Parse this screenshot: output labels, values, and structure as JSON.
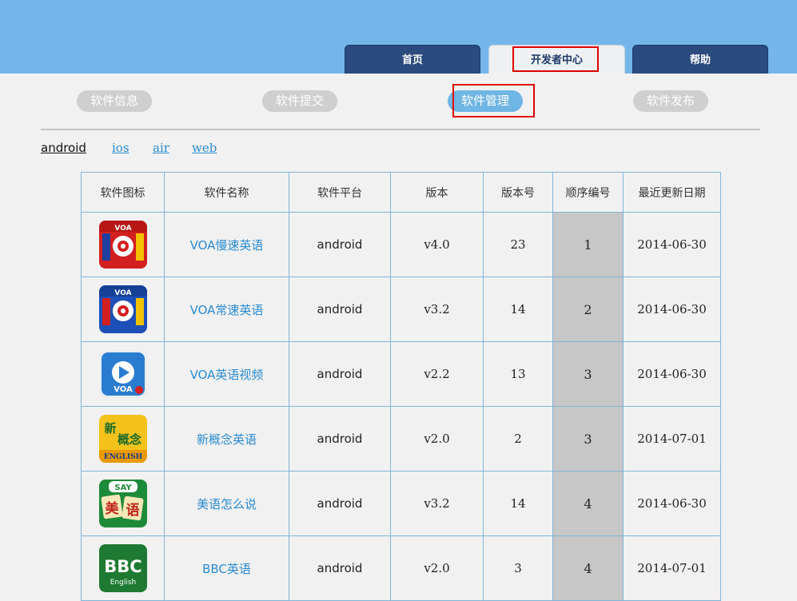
{
  "nav": {
    "tabs": [
      {
        "label": "首页"
      },
      {
        "label": "开发者中心"
      },
      {
        "label": "帮助"
      }
    ]
  },
  "subnav": {
    "items": [
      {
        "label": "软件信息"
      },
      {
        "label": "软件提交"
      },
      {
        "label": "软件管理"
      },
      {
        "label": "软件发布"
      }
    ]
  },
  "platforms": [
    "android",
    "ios",
    "air",
    "web"
  ],
  "table": {
    "headers": [
      "软件图标",
      "软件名称",
      "软件平台",
      "版本",
      "版本号",
      "顺序编号",
      "最近更新日期"
    ],
    "rows": [
      {
        "icon": "voa-slow-icon",
        "name": "VOA慢速英语",
        "platform": "android",
        "version": "v4.0",
        "build": "23",
        "order": "1",
        "date": "2014-06-30"
      },
      {
        "icon": "voa-normal-icon",
        "name": "VOA常速英语",
        "platform": "android",
        "version": "v3.2",
        "build": "14",
        "order": "2",
        "date": "2014-06-30"
      },
      {
        "icon": "voa-video-icon",
        "name": "VOA英语视频",
        "platform": "android",
        "version": "v2.2",
        "build": "13",
        "order": "3",
        "date": "2014-06-30"
      },
      {
        "icon": "new-concept-icon",
        "name": "新概念英语",
        "platform": "android",
        "version": "v2.0",
        "build": "2",
        "order": "3",
        "date": "2014-07-01"
      },
      {
        "icon": "say-english-icon",
        "name": "美语怎么说",
        "platform": "android",
        "version": "v3.2",
        "build": "14",
        "order": "4",
        "date": "2014-06-30"
      },
      {
        "icon": "bbc-english-icon",
        "name": "BBC英语",
        "platform": "android",
        "version": "v2.0",
        "build": "3",
        "order": "4",
        "date": "2014-07-01"
      }
    ]
  },
  "icon_text": {
    "voa": "VOA",
    "new_concept_1": "新",
    "new_concept_2": "概念",
    "new_concept_3": "ENGLISH",
    "say_1": "SAY",
    "say_2": "美",
    "say_3": "语",
    "bbc_1": "BBC",
    "bbc_2": "English"
  },
  "colors": {
    "header_bg": "#74b6ea",
    "tab_dark": "#2b4a7e",
    "pill_active": "#6fb6e4",
    "pill_inactive": "#cfcfcf",
    "link": "#2a8bd0",
    "highlight": "#e00000",
    "order_cell": "#c7c7c7"
  }
}
